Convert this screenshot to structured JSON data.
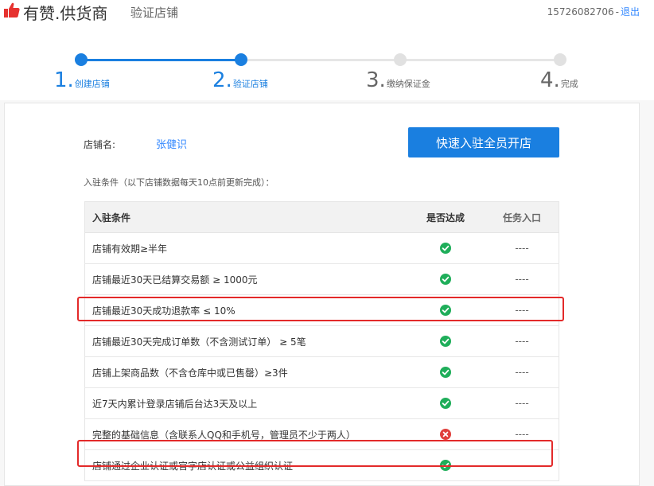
{
  "header": {
    "brand": "有赞.供货商",
    "subtitle": "验证店铺",
    "phone": "15726082706",
    "separator": "-",
    "logout": "退出",
    "colors": {
      "brand_red": "#e6322f",
      "link": "#3388ff"
    }
  },
  "stepper": {
    "current_step": 2,
    "steps": [
      {
        "num": "1.",
        "label": "创建店铺",
        "state": "done"
      },
      {
        "num": "2.",
        "label": "验证店铺",
        "state": "current"
      },
      {
        "num": "3.",
        "label": "缴纳保证金",
        "state": "todo"
      },
      {
        "num": "4.",
        "label": "完成",
        "state": "todo"
      }
    ],
    "colors": {
      "active": "#1a7fe0",
      "inactive": "#e1e1e1"
    }
  },
  "shop": {
    "label": "店铺名:",
    "name": "张健识",
    "open_button": "快速入驻全员开店"
  },
  "conditions": {
    "note": "入驻条件（以下店铺数据每天10点前更新完成）：",
    "headers": {
      "name": "入驻条件",
      "met": "是否达成",
      "task": "任务入口"
    },
    "rows": [
      {
        "name": "店铺有效期≥半年",
        "met": true,
        "task": "----",
        "highlighted": false
      },
      {
        "name": "店铺最近30天已结算交易额 ≥ 1000元",
        "met": true,
        "task": "----",
        "highlighted": false
      },
      {
        "name": "店铺最近30天成功退款率 ≤ 10%",
        "met": true,
        "task": "----",
        "highlighted": true
      },
      {
        "name": "店铺最近30天完成订单数（不含测试订单） ≥ 5笔",
        "met": true,
        "task": "----",
        "highlighted": false
      },
      {
        "name": "店铺上架商品数（不含仓库中或已售罄）≥3件",
        "met": true,
        "task": "----",
        "highlighted": false
      },
      {
        "name": "近7天内累计登录店铺后台达3天及以上",
        "met": true,
        "task": "----",
        "highlighted": false
      },
      {
        "name": "完整的基础信息（含联系人QQ和手机号，管理员不少于两人）",
        "met": false,
        "task": "----",
        "highlighted": false
      },
      {
        "name": "店铺通过企业认证或官字店认证或公益组织认证",
        "met": true,
        "task": "----",
        "highlighted": true
      }
    ],
    "colors": {
      "ok": "#1fae5a",
      "fail": "#e0403c",
      "highlight": "#e32a2a"
    }
  }
}
